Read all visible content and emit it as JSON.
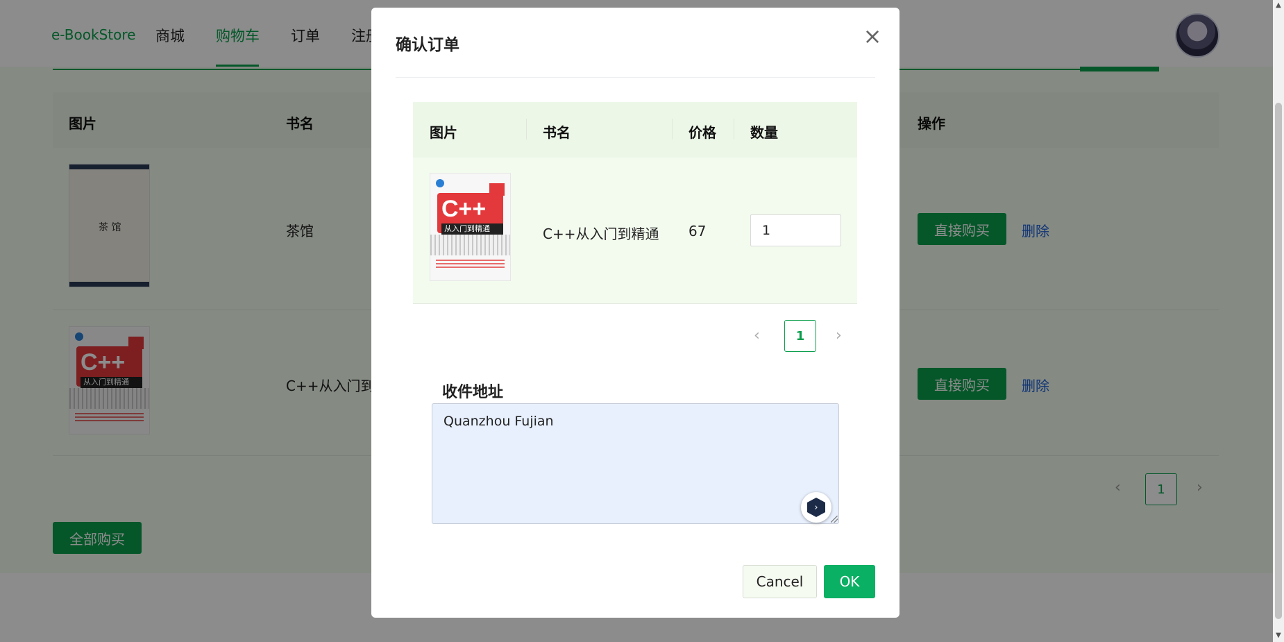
{
  "header": {
    "brand": "e-BookStore",
    "nav": [
      "商城",
      "购物车",
      "订单",
      "注册"
    ]
  },
  "cart": {
    "columns": [
      "图片",
      "书名",
      "操作"
    ],
    "rows": [
      {
        "title": "茶馆",
        "cover_text": "茶 馆",
        "buy_label": "直接购买",
        "delete_label": "删除"
      },
      {
        "title": "C++从入门到",
        "cover_text": "C++",
        "cover_band": "从入门到精通",
        "buy_label": "直接购买",
        "delete_label": "删除"
      }
    ],
    "page": "1",
    "buy_all_label": "全部购买"
  },
  "modal": {
    "title": "确认订单",
    "close_glyph": "×",
    "columns": [
      "图片",
      "书名",
      "价格",
      "数量"
    ],
    "item": {
      "cover_text": "C++",
      "cover_band": "从入门到精通",
      "name": "C++从入门到精通",
      "price": "67",
      "quantity": "1"
    },
    "page": "1",
    "address_label": "收件地址",
    "address_value": "Quanzhou Fujian",
    "cancel_label": "Cancel",
    "ok_label": "OK"
  },
  "icons": {
    "prev": "‹",
    "next": "›"
  }
}
